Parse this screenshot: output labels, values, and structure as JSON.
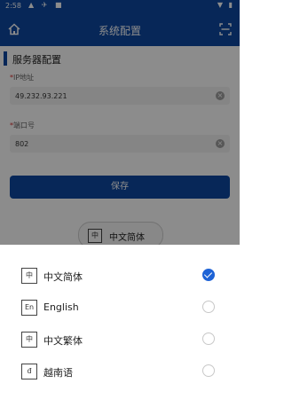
{
  "status_bar": {
    "time": "2:58",
    "left_icons": "▲ ✈ ■",
    "right_icons": "▼ ▮"
  },
  "app_bar": {
    "title": "系统配置",
    "home_icon": "home-icon",
    "scan_icon": "scan-icon"
  },
  "section": {
    "title": "服务器配置"
  },
  "fields": [
    {
      "required_mark": "*",
      "label": "IP地址",
      "value": "49.232.93.221"
    },
    {
      "required_mark": "*",
      "label": "端口号",
      "value": "802"
    }
  ],
  "save_button": {
    "label": "保存"
  },
  "language_pill": {
    "icon_text": "中",
    "label": "中文简体"
  },
  "language_options": [
    {
      "icon_text": "中",
      "label": "中文简体",
      "selected": true
    },
    {
      "icon_text": "En",
      "label": "English",
      "selected": false
    },
    {
      "icon_text": "中",
      "label": "中文繁体",
      "selected": false
    },
    {
      "icon_text": "đ",
      "label": "越南语",
      "selected": false
    }
  ],
  "colors": {
    "primary": "#0d47a1",
    "check": "#1e63d6"
  }
}
